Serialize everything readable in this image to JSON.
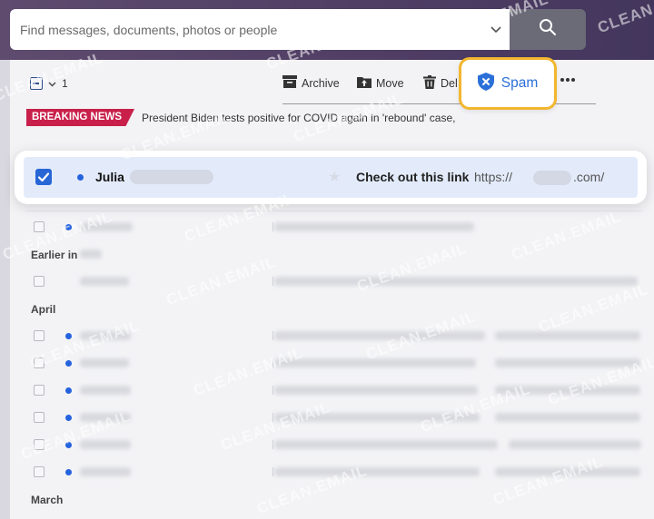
{
  "search": {
    "placeholder": "Find messages, documents, photos or people"
  },
  "toolbar": {
    "selected_count": "1",
    "archive_label": "Archive",
    "move_label": "Move",
    "delete_label": "Del",
    "spam_label": "Spam"
  },
  "breaking_news": {
    "badge": "BREAKING NEWS",
    "headline": "President Biden tests positive for COVID again in 'rebound' case,"
  },
  "highlighted_email": {
    "sender": "Julia",
    "subject": "Check out this link",
    "link_prefix": "https://",
    "link_suffix": ".com/",
    "selected": true
  },
  "sections": {
    "earlier": "Earlier in",
    "april": "April",
    "march": "March"
  },
  "watermark": "CLEAN.EMAIL",
  "colors": {
    "topbar": "#4f3d64",
    "accent_blue": "#2866d6",
    "spam_highlight": "#f2b62f",
    "breaking_badge": "#c8204a"
  },
  "icons": {
    "search": "search-icon",
    "archive": "archive-icon",
    "move": "move-icon",
    "delete": "trash-icon",
    "spam": "shield-x-icon",
    "more": "more-icon"
  }
}
